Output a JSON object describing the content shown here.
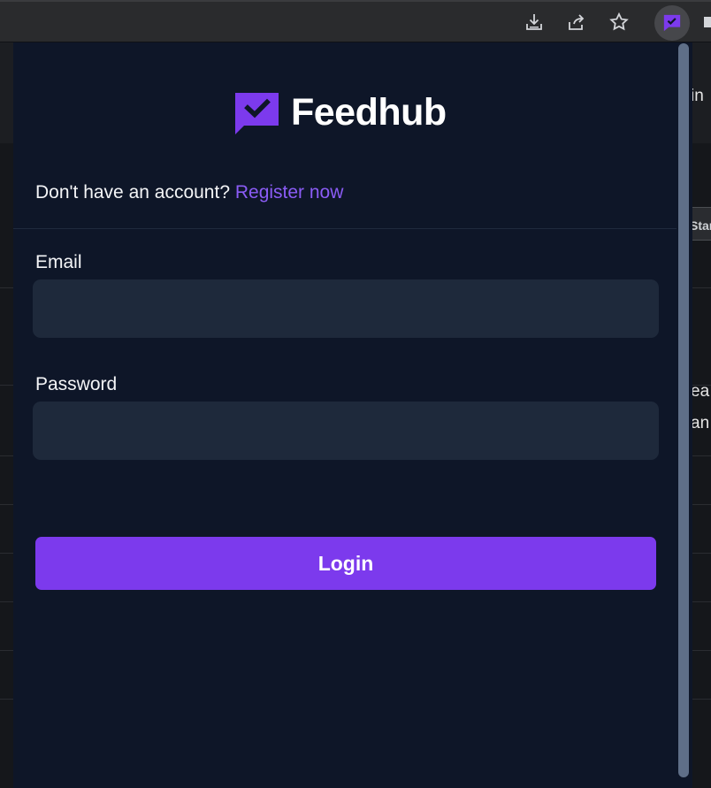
{
  "browser": {
    "icons": [
      "download-icon",
      "share-icon",
      "star-icon",
      "feedhub-extension-icon",
      "puzzle-icon"
    ]
  },
  "background_page": {
    "snippets": [
      "in",
      "Star",
      "ea",
      "an"
    ]
  },
  "popup": {
    "logo_text": "Feedhub",
    "register_prompt": "Don't have an account?",
    "register_link": "Register now",
    "email_label": "Email",
    "email_value": "",
    "password_label": "Password",
    "password_value": "",
    "login_label": "Login"
  },
  "colors": {
    "popup_bg": "#0e1628",
    "input_bg": "#1e293b",
    "accent": "#7c3aed",
    "link": "#8b5cf6"
  }
}
